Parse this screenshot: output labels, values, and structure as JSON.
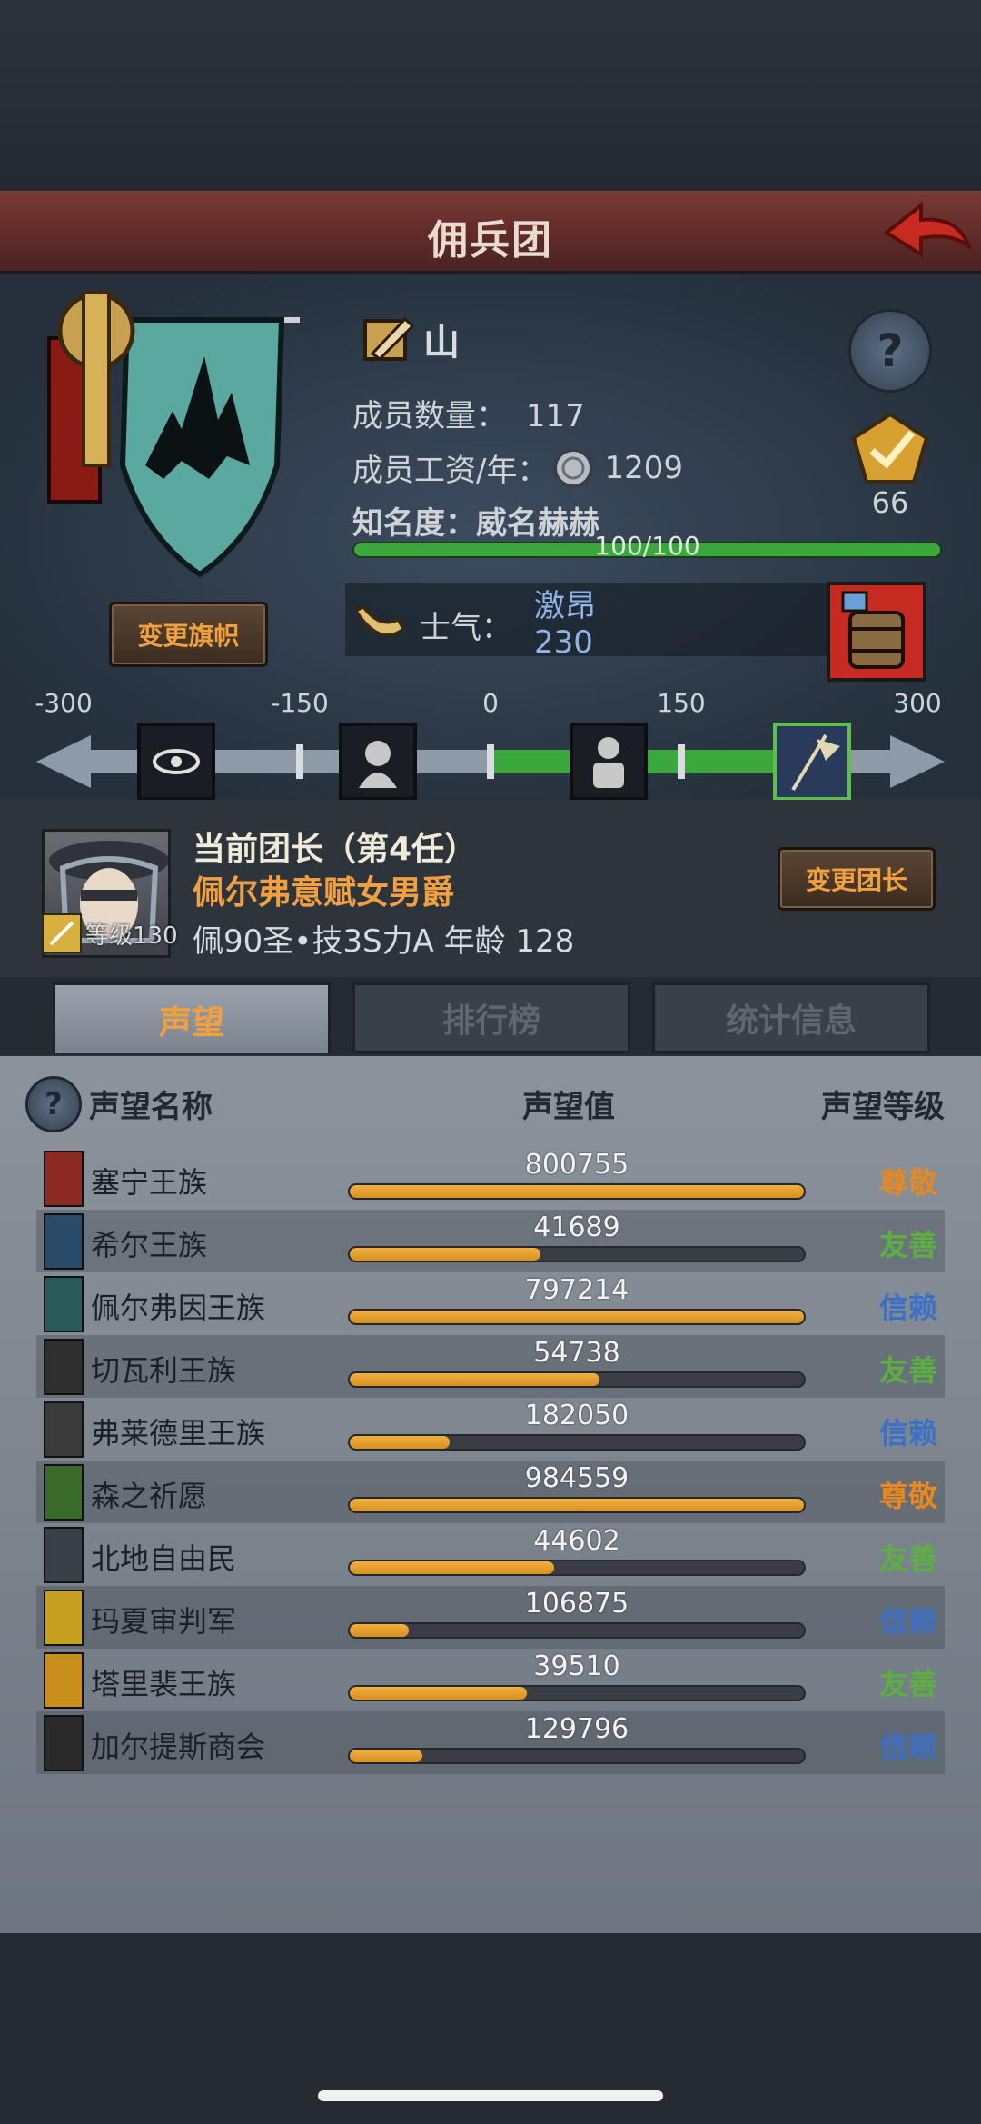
{
  "header": {
    "title": "佣兵团"
  },
  "company": {
    "name": "山",
    "members_label": "成员数量：",
    "members_value": "117",
    "salary_label": "成员工资/年：",
    "salary_value": "1209",
    "fame_label": "知名度：",
    "fame_value": "威名赫赫",
    "fame_progress_text": "100/100",
    "fame_progress": 1.0,
    "change_flag_label": "变更旗帜",
    "badge_count": "66"
  },
  "morale": {
    "label": "士气：",
    "state": "激昂",
    "value": "230",
    "scale_ticks": [
      "-300",
      "-150",
      "0",
      "150",
      "300"
    ],
    "range": [
      -300,
      300
    ],
    "current": 230
  },
  "leader": {
    "title": "当前团长（第4任）",
    "name": "佩尔弗意赋女男爵",
    "level_text": "等级130",
    "info": "佩90圣•技3S力A  年龄  128",
    "change_label": "变更团长"
  },
  "tabs": [
    {
      "label": "声望",
      "active": true
    },
    {
      "label": "排行榜",
      "active": false
    },
    {
      "label": "统计信息",
      "active": false
    }
  ],
  "table": {
    "headers": {
      "name": "声望名称",
      "value": "声望值",
      "level": "声望等级"
    },
    "rows": [
      {
        "name": "塞宁王族",
        "value": "800755",
        "progress": 1.0,
        "level": "尊敬",
        "level_color": "#e8881e",
        "icon_color": "#8a2a20"
      },
      {
        "name": "希尔王族",
        "value": "41689",
        "progress": 0.42,
        "level": "友善",
        "level_color": "#5cb040",
        "icon_color": "#2a4a6a"
      },
      {
        "name": "佩尔弗因王族",
        "value": "797214",
        "progress": 1.0,
        "level": "信赖",
        "level_color": "#3a70c8",
        "icon_color": "#2a5a5a"
      },
      {
        "name": "切瓦利王族",
        "value": "54738",
        "progress": 0.55,
        "level": "友善",
        "level_color": "#5cb040",
        "icon_color": "#303030"
      },
      {
        "name": "弗莱德里王族",
        "value": "182050",
        "progress": 0.22,
        "level": "信赖",
        "level_color": "#3a70c8",
        "icon_color": "#3a3a3a"
      },
      {
        "name": "森之祈愿",
        "value": "984559",
        "progress": 1.0,
        "level": "尊敬",
        "level_color": "#e8881e",
        "icon_color": "#3a6a2a"
      },
      {
        "name": "北地自由民",
        "value": "44602",
        "progress": 0.45,
        "level": "友善",
        "level_color": "#5cb040",
        "icon_color": "#3a4048"
      },
      {
        "name": "玛夏审判军",
        "value": "106875",
        "progress": 0.13,
        "level": "信赖",
        "level_color": "#3a70c8",
        "icon_color": "#c8a020"
      },
      {
        "name": "塔里裴王族",
        "value": "39510",
        "progress": 0.39,
        "level": "友善",
        "level_color": "#5cb040",
        "icon_color": "#c8901a"
      },
      {
        "name": "加尔提斯商会",
        "value": "129796",
        "progress": 0.16,
        "level": "信赖",
        "level_color": "#3a70c8",
        "icon_color": "#2a2a2a"
      }
    ]
  }
}
